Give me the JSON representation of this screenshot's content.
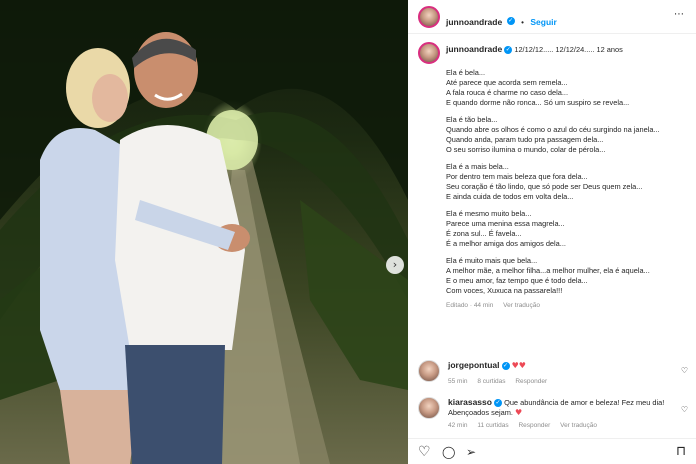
{
  "post": {
    "username": "junnoandrade",
    "verified_mark": "✓",
    "follow_sep": "•",
    "follow_label": "Seguir",
    "more_icon": "⋯"
  },
  "caption": {
    "username": "junnoandrade",
    "header_text": "12/12/12..... 12/12/24..... 12 anos",
    "stanzas": [
      [
        "Ela é bela...",
        "Até parece que acorda sem remela...",
        "A fala rouca é charme no caso dela...",
        "E quando dorme não ronca... Só um suspiro se revela..."
      ],
      [
        "Ela é tão bela...",
        "Quando abre os olhos é como o azul do céu surgindo na janela...",
        "Quando anda, param tudo pra passagem dela...",
        "O seu sorriso ilumina o mundo, colar de pérola..."
      ],
      [
        "Ela é a mais bela...",
        "Por dentro tem mais beleza que fora dela...",
        "Seu coração é tão lindo, que só pode ser Deus quem zela...",
        "E ainda cuida de todos em volta dela..."
      ],
      [
        "Ela é mesmo muito bela...",
        "Parece uma menina essa magrela...",
        "É zona sul... É favela...",
        "É a melhor amiga dos amigos dela..."
      ],
      [
        "Ela é muito mais que bela...",
        "A melhor mãe, a melhor filha...a melhor mulher, ela é aquela...",
        "E o meu amor, faz tempo que é todo dela...",
        "Com voces, Xuxuca na passarela!!!"
      ]
    ],
    "edited": "Editado · 44 min",
    "translate": "Ver tradução"
  },
  "comments": [
    {
      "username": "jorgepontual",
      "hearts": "♥♥",
      "text": "",
      "time": "55 min",
      "likes": "8 curtidas",
      "reply": "Responder",
      "translate": ""
    },
    {
      "username": "kiarasasso",
      "text": "Que abundância de amor e beleza! Fez meu dia!",
      "text2": "Abençoados sejam.",
      "hearts": "♥",
      "time": "42 min",
      "likes": "11 curtidas",
      "reply": "Responder",
      "translate": "Ver tradução"
    }
  ],
  "icons": {
    "heart": "♡",
    "comment": "◯",
    "share": "➢",
    "save": "⊓",
    "next": "›"
  },
  "colors": {
    "accent": "#0095f6",
    "like_red": "#ed4956",
    "story_ring": "#d92e7f"
  }
}
